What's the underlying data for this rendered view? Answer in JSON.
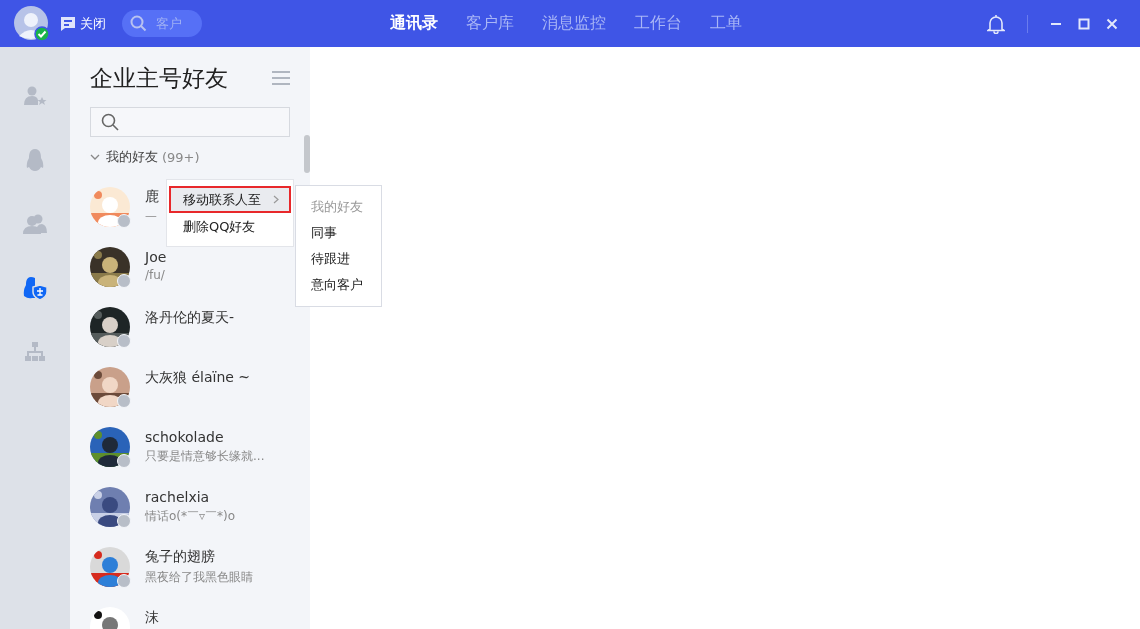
{
  "top_bar": {
    "close_label": "关闭",
    "search": {
      "placeholder": "客户"
    },
    "nav": [
      {
        "label": "通讯录",
        "selected": true
      },
      {
        "label": "客户库",
        "selected": false
      },
      {
        "label": "消息监控",
        "selected": false
      },
      {
        "label": "工作台",
        "selected": false
      },
      {
        "label": "工单",
        "selected": false
      }
    ]
  },
  "rail": {
    "items": [
      {
        "kind": "favorite",
        "selected": false
      },
      {
        "kind": "penguin",
        "selected": false
      },
      {
        "kind": "group",
        "selected": false
      },
      {
        "kind": "enterprise",
        "selected": true
      },
      {
        "kind": "org",
        "selected": false
      }
    ]
  },
  "contact_panel": {
    "title": "企业主号好友",
    "group": {
      "label": "我的好友",
      "count": "(99+)",
      "expanded": true
    },
    "contacts": [
      {
        "name": "鹿",
        "status": "一"
      },
      {
        "name": "Joe",
        "status": "/fu/"
      },
      {
        "name": "洛丹伦的夏天-"
      },
      {
        "name": "大灰狼 élaïne ~"
      },
      {
        "name": "schokolade",
        "status": "只要是情意够长缘就..."
      },
      {
        "name": "rachelxia",
        "status": "情话o(*￣▿￣*)o"
      },
      {
        "name": "兔子的翅膀",
        "status": "黑夜给了我黑色眼睛"
      },
      {
        "name": "沫"
      }
    ]
  },
  "context_menu": {
    "items": [
      {
        "label": "移动联系人至",
        "highlighted": true,
        "has_submenu": true
      },
      {
        "label": "删除QQ好友",
        "highlighted": false,
        "has_submenu": false
      }
    ]
  },
  "submenu": {
    "items": [
      {
        "label": "我的好友",
        "disabled": true
      },
      {
        "label": "同事",
        "disabled": false
      },
      {
        "label": "待跟进",
        "disabled": false
      },
      {
        "label": "意向客户",
        "disabled": false
      }
    ]
  }
}
